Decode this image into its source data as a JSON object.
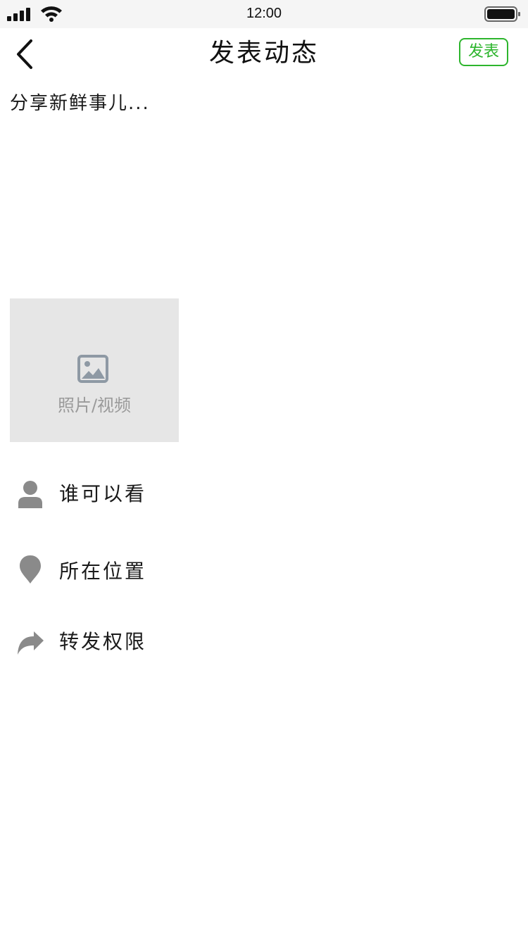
{
  "status_bar": {
    "time": "12:00",
    "icons": [
      "signal-icon",
      "wifi-icon",
      "battery-icon"
    ]
  },
  "nav": {
    "title": "发表动态",
    "publish_label": "发表",
    "back_icon": "chevron-left-icon"
  },
  "composer": {
    "placeholder": "分享新鲜事儿..."
  },
  "media": {
    "label": "照片/视频",
    "icon": "image-icon"
  },
  "options": [
    {
      "label": "谁可以看",
      "icon": "person-icon"
    },
    {
      "label": "所在位置",
      "icon": "location-pin-icon"
    },
    {
      "label": "转发权限",
      "icon": "share-arrow-icon"
    }
  ],
  "colors": {
    "accent": "#2db52d",
    "icon_gray": "#8a8a8a",
    "media_bg": "#e6e6e6",
    "status_bar_bg": "#f5f5f5"
  }
}
